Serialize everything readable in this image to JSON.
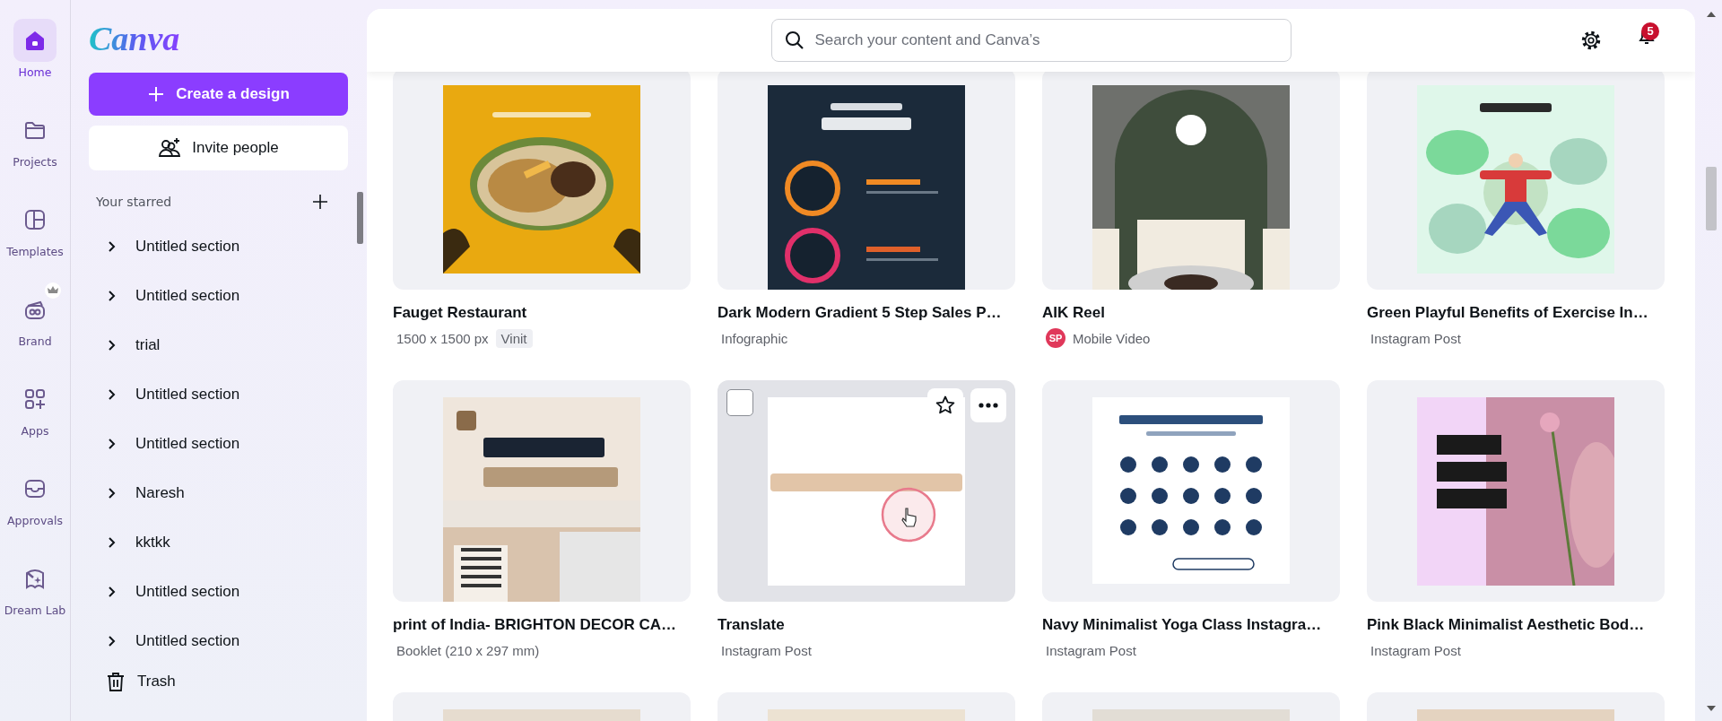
{
  "rail": [
    {
      "label": "Home",
      "selected": true
    },
    {
      "label": "Projects",
      "selected": false
    },
    {
      "label": "Templates",
      "selected": false
    },
    {
      "label": "Brand",
      "selected": false,
      "crown": true
    },
    {
      "label": "Apps",
      "selected": false
    },
    {
      "label": "Approvals",
      "selected": false
    },
    {
      "label": "Dream Lab",
      "selected": false
    }
  ],
  "sidebar": {
    "logo": "Canva",
    "create_button": "Create a design",
    "invite_button": "Invite people",
    "starred_heading": "Your starred",
    "items": [
      {
        "label": "Untitled section",
        "expanded": false
      },
      {
        "label": "Untitled section",
        "expanded": false
      },
      {
        "label": "trial",
        "expanded": false
      },
      {
        "label": "Untitled section",
        "expanded": false
      },
      {
        "label": "Untitled section",
        "expanded": false
      },
      {
        "label": "Naresh",
        "expanded": false
      },
      {
        "label": "kktkk",
        "expanded": false
      },
      {
        "label": "Untitled section",
        "expanded": false
      },
      {
        "label": "Untitled section",
        "expanded": false
      }
    ],
    "trash": "Trash"
  },
  "header": {
    "search": {
      "placeholder": "Search your content and Canva’s"
    },
    "notifications": {
      "count": "5"
    }
  },
  "designs": [
    {
      "title": "Fauget Restaurant",
      "subtitle": "1500 x 1500 px",
      "tag": "Vinit",
      "hovered": false
    },
    {
      "title": "Dark Modern Gradient 5 Step Sales P…",
      "subtitle": "Infographic",
      "hovered": false
    },
    {
      "title": "AIK Reel",
      "avatar": "SP",
      "subtitle": "Mobile Video",
      "hovered": false
    },
    {
      "title": "Green Playful Benefits of Exercise In…",
      "subtitle": "Instagram Post",
      "hovered": false
    },
    {
      "title": "print  of India- BRIGHTON DECOR CA…",
      "subtitle": "Booklet (210 x 297 mm)",
      "hovered": false
    },
    {
      "title": "Translate",
      "subtitle": "Instagram Post",
      "hovered": true,
      "checked": false
    },
    {
      "title": "Navy Minimalist Yoga Class Instagra…",
      "subtitle": "Instagram Post",
      "hovered": false
    },
    {
      "title": "Pink Black Minimalist Aesthetic Bod…",
      "subtitle": "Instagram Post",
      "hovered": false
    },
    {
      "hovered": false
    },
    {
      "hovered": false
    },
    {
      "hovered": false
    },
    {
      "hovered": false
    }
  ]
}
